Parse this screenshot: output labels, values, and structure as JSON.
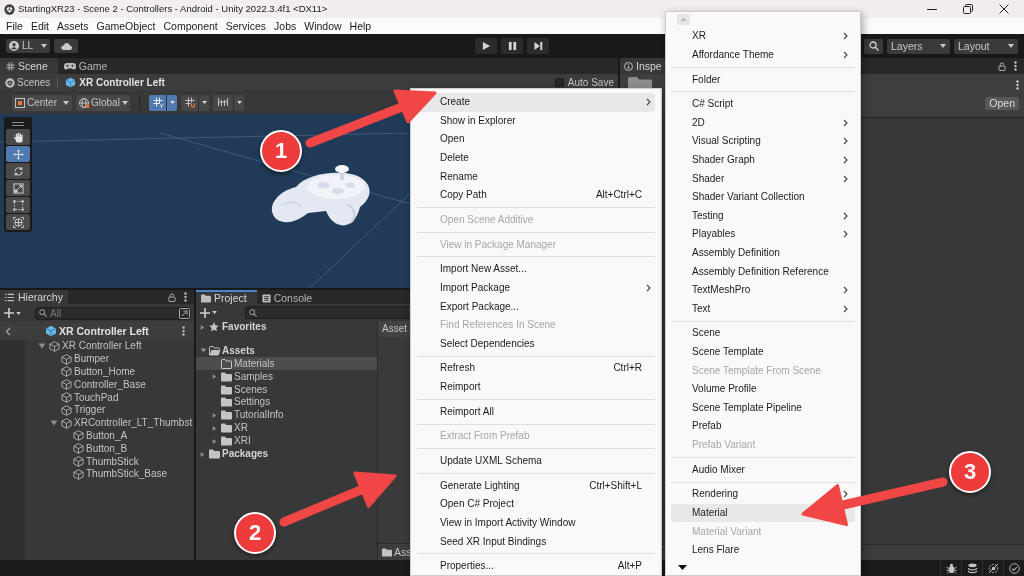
{
  "window": {
    "title": "StartingXR23 - Scene 2 - Controllers - Android - Unity 2022.3.4f1 <DX11>"
  },
  "menu_bar": [
    "File",
    "Edit",
    "Assets",
    "GameObject",
    "Component",
    "Services",
    "Jobs",
    "Window",
    "Help"
  ],
  "toolbar": {
    "account": "LL",
    "layers": "Layers",
    "layout": "Layout"
  },
  "scene_panel": {
    "tabs": [
      {
        "label": "Scene",
        "selected": true
      },
      {
        "label": "Game",
        "selected": false
      }
    ],
    "breadcrumb": {
      "root": "Scenes",
      "current": "XR Controller Left"
    },
    "auto_save": {
      "label": "Auto Save",
      "checked": false
    },
    "pivot": "Center",
    "space": "Global",
    "view_toggles": [
      {
        "active": true
      },
      {
        "active": false
      },
      {
        "active": false
      }
    ],
    "tools": [
      {
        "selected": false
      },
      {
        "selected": true
      },
      {
        "selected": false
      },
      {
        "selected": false
      },
      {
        "selected": false
      },
      {
        "selected": false
      }
    ]
  },
  "inspector": {
    "tab": "Inspe",
    "open_button": "Open"
  },
  "hierarchy": {
    "tab": "Hierarchy",
    "search_placeholder": "All",
    "header": "XR Controller Left",
    "tree": [
      {
        "label": "XR Controller Left",
        "expanded": true,
        "children": [
          {
            "label": "Bumper"
          },
          {
            "label": "Button_Home"
          },
          {
            "label": "Controller_Base"
          },
          {
            "label": "TouchPad"
          },
          {
            "label": "Trigger"
          },
          {
            "label": "XRController_LT_Thumbst",
            "expanded": true,
            "children": [
              {
                "label": "Button_A"
              },
              {
                "label": "Button_B"
              },
              {
                "label": "ThumbStick"
              },
              {
                "label": "ThumbStick_Base"
              }
            ]
          }
        ]
      }
    ]
  },
  "project": {
    "tabs": [
      {
        "label": "Project",
        "selected": true
      },
      {
        "label": "Console",
        "selected": false
      }
    ],
    "tree": [
      {
        "label": "Favorites",
        "kind": "favorites",
        "expanded": false,
        "selected": false
      },
      {
        "label": "Assets",
        "kind": "folder",
        "expanded": true,
        "selected": false,
        "children": [
          {
            "label": "Materials",
            "kind": "empty_folder",
            "selected": true
          },
          {
            "label": "Samples",
            "kind": "folder",
            "expanded": false,
            "selected": false
          },
          {
            "label": "Scenes",
            "kind": "folder",
            "selected": false
          },
          {
            "label": "Settings",
            "kind": "folder",
            "selected": false
          },
          {
            "label": "TutorialInfo",
            "kind": "folder",
            "expanded": false,
            "selected": false
          },
          {
            "label": "XR",
            "kind": "folder",
            "expanded": false,
            "selected": false
          },
          {
            "label": "XRI",
            "kind": "folder",
            "expanded": false,
            "selected": false
          }
        ]
      },
      {
        "label": "Packages",
        "kind": "folder",
        "expanded": false,
        "selected": false
      }
    ],
    "path": "Asset",
    "footer": "Ass"
  },
  "context_menu": {
    "items": [
      {
        "kind": "item",
        "label": "Create",
        "submenu": true,
        "disabled": false,
        "selected": true
      },
      {
        "kind": "item",
        "label": "Show in Explorer",
        "submenu": false,
        "disabled": false,
        "selected": false
      },
      {
        "kind": "item",
        "label": "Open",
        "submenu": false,
        "disabled": false,
        "selected": false
      },
      {
        "kind": "item",
        "label": "Delete",
        "submenu": false,
        "disabled": false,
        "selected": false
      },
      {
        "kind": "item",
        "label": "Rename",
        "submenu": false,
        "disabled": false,
        "selected": false
      },
      {
        "kind": "item",
        "label": "Copy Path",
        "shortcut": "Alt+Ctrl+C",
        "submenu": false,
        "disabled": false,
        "selected": false
      },
      {
        "kind": "separator"
      },
      {
        "kind": "item",
        "label": "Open Scene Additive",
        "submenu": false,
        "disabled": true,
        "selected": false
      },
      {
        "kind": "separator"
      },
      {
        "kind": "item",
        "label": "View in Package Manager",
        "submenu": false,
        "disabled": true,
        "selected": false
      },
      {
        "kind": "separator"
      },
      {
        "kind": "item",
        "label": "Import New Asset...",
        "submenu": false,
        "disabled": false,
        "selected": false
      },
      {
        "kind": "item",
        "label": "Import Package",
        "submenu": true,
        "disabled": false,
        "selected": false
      },
      {
        "kind": "item",
        "label": "Export Package...",
        "submenu": false,
        "disabled": false,
        "selected": false
      },
      {
        "kind": "item",
        "label": "Find References In Scene",
        "submenu": false,
        "disabled": true,
        "selected": false
      },
      {
        "kind": "item",
        "label": "Select Dependencies",
        "submenu": false,
        "disabled": false,
        "selected": false
      },
      {
        "kind": "separator"
      },
      {
        "kind": "item",
        "label": "Refresh",
        "shortcut": "Ctrl+R",
        "submenu": false,
        "disabled": false,
        "selected": false
      },
      {
        "kind": "item",
        "label": "Reimport",
        "submenu": false,
        "disabled": false,
        "selected": false
      },
      {
        "kind": "separator"
      },
      {
        "kind": "item",
        "label": "Reimport All",
        "submenu": false,
        "disabled": false,
        "selected": false
      },
      {
        "kind": "separator"
      },
      {
        "kind": "item",
        "label": "Extract From Prefab",
        "submenu": false,
        "disabled": true,
        "selected": false
      },
      {
        "kind": "separator"
      },
      {
        "kind": "item",
        "label": "Update UXML Schema",
        "submenu": false,
        "disabled": false,
        "selected": false
      },
      {
        "kind": "separator"
      },
      {
        "kind": "item",
        "label": "Generate Lighting",
        "shortcut": "Ctrl+Shift+L",
        "submenu": false,
        "disabled": false,
        "selected": false
      },
      {
        "kind": "item",
        "label": "Open C# Project",
        "submenu": false,
        "disabled": false,
        "selected": false
      },
      {
        "kind": "item",
        "label": "View in Import Activity Window",
        "submenu": false,
        "disabled": false,
        "selected": false
      },
      {
        "kind": "item",
        "label": "Seed XR Input Bindings",
        "submenu": false,
        "disabled": false,
        "selected": false
      },
      {
        "kind": "separator"
      },
      {
        "kind": "item",
        "label": "Properties...",
        "shortcut": "Alt+P",
        "submenu": false,
        "disabled": false,
        "selected": false
      }
    ]
  },
  "create_submenu": {
    "items": [
      {
        "kind": "item",
        "label": "XR",
        "submenu": true,
        "disabled": false,
        "selected": false
      },
      {
        "kind": "item",
        "label": "Affordance Theme",
        "submenu": true,
        "disabled": false,
        "selected": false
      },
      {
        "kind": "separator"
      },
      {
        "kind": "item",
        "label": "Folder",
        "submenu": false,
        "disabled": false,
        "selected": false
      },
      {
        "kind": "separator"
      },
      {
        "kind": "item",
        "label": "C# Script",
        "submenu": false,
        "disabled": false,
        "selected": false
      },
      {
        "kind": "item",
        "label": "2D",
        "submenu": true,
        "disabled": false,
        "selected": false
      },
      {
        "kind": "item",
        "label": "Visual Scripting",
        "submenu": true,
        "disabled": false,
        "selected": false
      },
      {
        "kind": "item",
        "label": "Shader Graph",
        "submenu": true,
        "disabled": false,
        "selected": false
      },
      {
        "kind": "item",
        "label": "Shader",
        "submenu": true,
        "disabled": false,
        "selected": false
      },
      {
        "kind": "item",
        "label": "Shader Variant Collection",
        "submenu": false,
        "disabled": false,
        "selected": false
      },
      {
        "kind": "item",
        "label": "Testing",
        "submenu": true,
        "disabled": false,
        "selected": false
      },
      {
        "kind": "item",
        "label": "Playables",
        "submenu": true,
        "disabled": false,
        "selected": false
      },
      {
        "kind": "item",
        "label": "Assembly Definition",
        "submenu": false,
        "disabled": false,
        "selected": false
      },
      {
        "kind": "item",
        "label": "Assembly Definition Reference",
        "submenu": false,
        "disabled": false,
        "selected": false
      },
      {
        "kind": "item",
        "label": "TextMeshPro",
        "submenu": true,
        "disabled": false,
        "selected": false
      },
      {
        "kind": "item",
        "label": "Text",
        "submenu": true,
        "disabled": false,
        "selected": false
      },
      {
        "kind": "separator"
      },
      {
        "kind": "item",
        "label": "Scene",
        "submenu": false,
        "disabled": false,
        "selected": false
      },
      {
        "kind": "item",
        "label": "Scene Template",
        "submenu": false,
        "disabled": false,
        "selected": false
      },
      {
        "kind": "item",
        "label": "Scene Template From Scene",
        "submenu": false,
        "disabled": true,
        "selected": false
      },
      {
        "kind": "item",
        "label": "Volume Profile",
        "submenu": false,
        "disabled": false,
        "selected": false
      },
      {
        "kind": "item",
        "label": "Scene Template Pipeline",
        "submenu": false,
        "disabled": false,
        "selected": false
      },
      {
        "kind": "item",
        "label": "Prefab",
        "submenu": false,
        "disabled": false,
        "selected": false
      },
      {
        "kind": "item",
        "label": "Prefab Variant",
        "submenu": false,
        "disabled": true,
        "selected": false
      },
      {
        "kind": "separator"
      },
      {
        "kind": "item",
        "label": "Audio Mixer",
        "submenu": false,
        "disabled": false,
        "selected": false
      },
      {
        "kind": "separator"
      },
      {
        "kind": "item",
        "label": "Rendering",
        "submenu": true,
        "disabled": false,
        "selected": false
      },
      {
        "kind": "item",
        "label": "Material",
        "submenu": false,
        "disabled": false,
        "selected": true
      },
      {
        "kind": "item",
        "label": "Material Variant",
        "submenu": false,
        "disabled": true,
        "selected": false
      },
      {
        "kind": "item",
        "label": "Lens Flare",
        "submenu": false,
        "disabled": false,
        "selected": false
      }
    ]
  },
  "annotations": [
    {
      "number": "1"
    },
    {
      "number": "2"
    },
    {
      "number": "3"
    }
  ]
}
